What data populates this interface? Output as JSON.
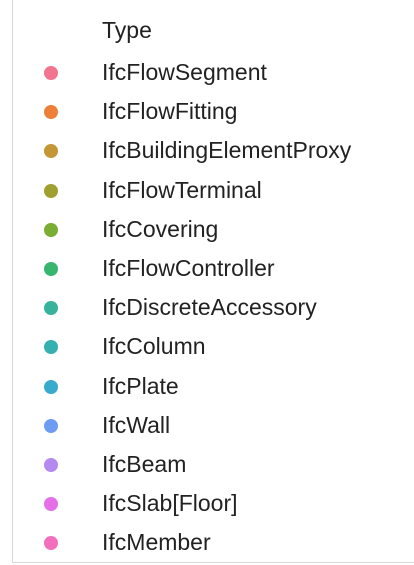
{
  "chart_data": {
    "type": "scatter",
    "legend": {
      "title": "Type",
      "entries": [
        {
          "label": "IfcFlowSegment",
          "color": "#f2748f"
        },
        {
          "label": "IfcFlowFitting",
          "color": "#ec7f3a"
        },
        {
          "label": "IfcBuildingElementProxy",
          "color": "#c49636"
        },
        {
          "label": "IfcFlowTerminal",
          "color": "#a0a030"
        },
        {
          "label": "IfcCovering",
          "color": "#79ad33"
        },
        {
          "label": "IfcFlowController",
          "color": "#38b66d"
        },
        {
          "label": "IfcDiscreteAccessory",
          "color": "#37b29b"
        },
        {
          "label": "IfcColumn",
          "color": "#36afb0"
        },
        {
          "label": "IfcPlate",
          "color": "#38aacd"
        },
        {
          "label": "IfcWall",
          "color": "#6d9cf2"
        },
        {
          "label": "IfcBeam",
          "color": "#b58af0"
        },
        {
          "label": "IfcSlab[Floor]",
          "color": "#e46fe8"
        },
        {
          "label": "IfcMember",
          "color": "#f36fbc"
        }
      ]
    }
  }
}
